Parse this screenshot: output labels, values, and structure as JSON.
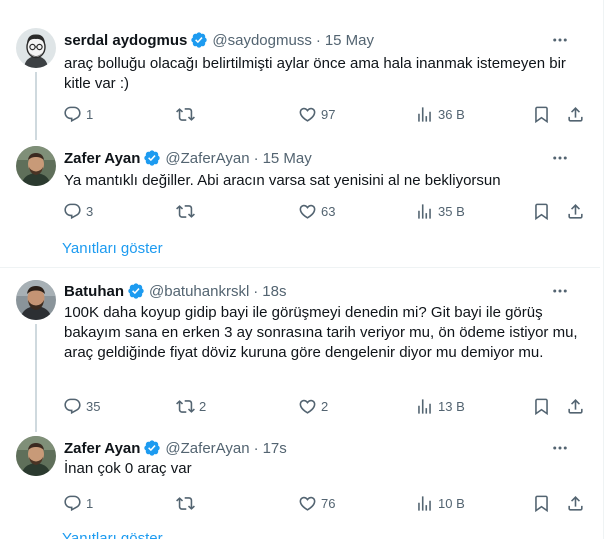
{
  "tweets": [
    {
      "name": "serdal aydogmus",
      "handle": "@saydogmuss",
      "time": "15 May",
      "text": "araç bolluğu olacağı belirtilmişti aylar önce ama hala inanmak istemeyen bir kitle var :)",
      "replies": "1",
      "retweets": "",
      "likes": "97",
      "views": "36 B",
      "avatar_icon": "cartoon-avatar"
    },
    {
      "name": "Zafer Ayan",
      "handle": "@ZaferAyan",
      "time": "15 May",
      "text": "Ya mantıklı değiller. Abi aracın varsa sat yenisini al ne bekliyorsun",
      "replies": "3",
      "retweets": "",
      "likes": "63",
      "views": "35 B",
      "avatar_icon": "photo-avatar"
    },
    {
      "name": "Batuhan",
      "handle": "@batuhankrskl",
      "time": "18s",
      "text": "100K daha koyup gidip bayi ile görüşmeyi denedin mi? Git bayi ile görüş bakayım sana en erken 3 ay sonrasına tarih veriyor mu, ön ödeme istiyor mu, araç geldiğinde fiyat döviz kuruna göre dengelenir diyor mu demiyor mu.",
      "replies": "35",
      "retweets": "2",
      "likes": "2",
      "views": "13 B",
      "avatar_icon": "photo-avatar"
    },
    {
      "name": "Zafer Ayan",
      "handle": "@ZaferAyan",
      "time": "17s",
      "text": "İnan çok 0 araç var",
      "replies": "1",
      "retweets": "",
      "likes": "76",
      "views": "10 B",
      "avatar_icon": "photo-avatar"
    }
  ],
  "show_replies_label": "Yanıtları göster",
  "colors": {
    "accent": "#1d9bf0",
    "secondary_text": "#536471",
    "primary_text": "#0f1419",
    "thread_line": "#cfd9de"
  }
}
